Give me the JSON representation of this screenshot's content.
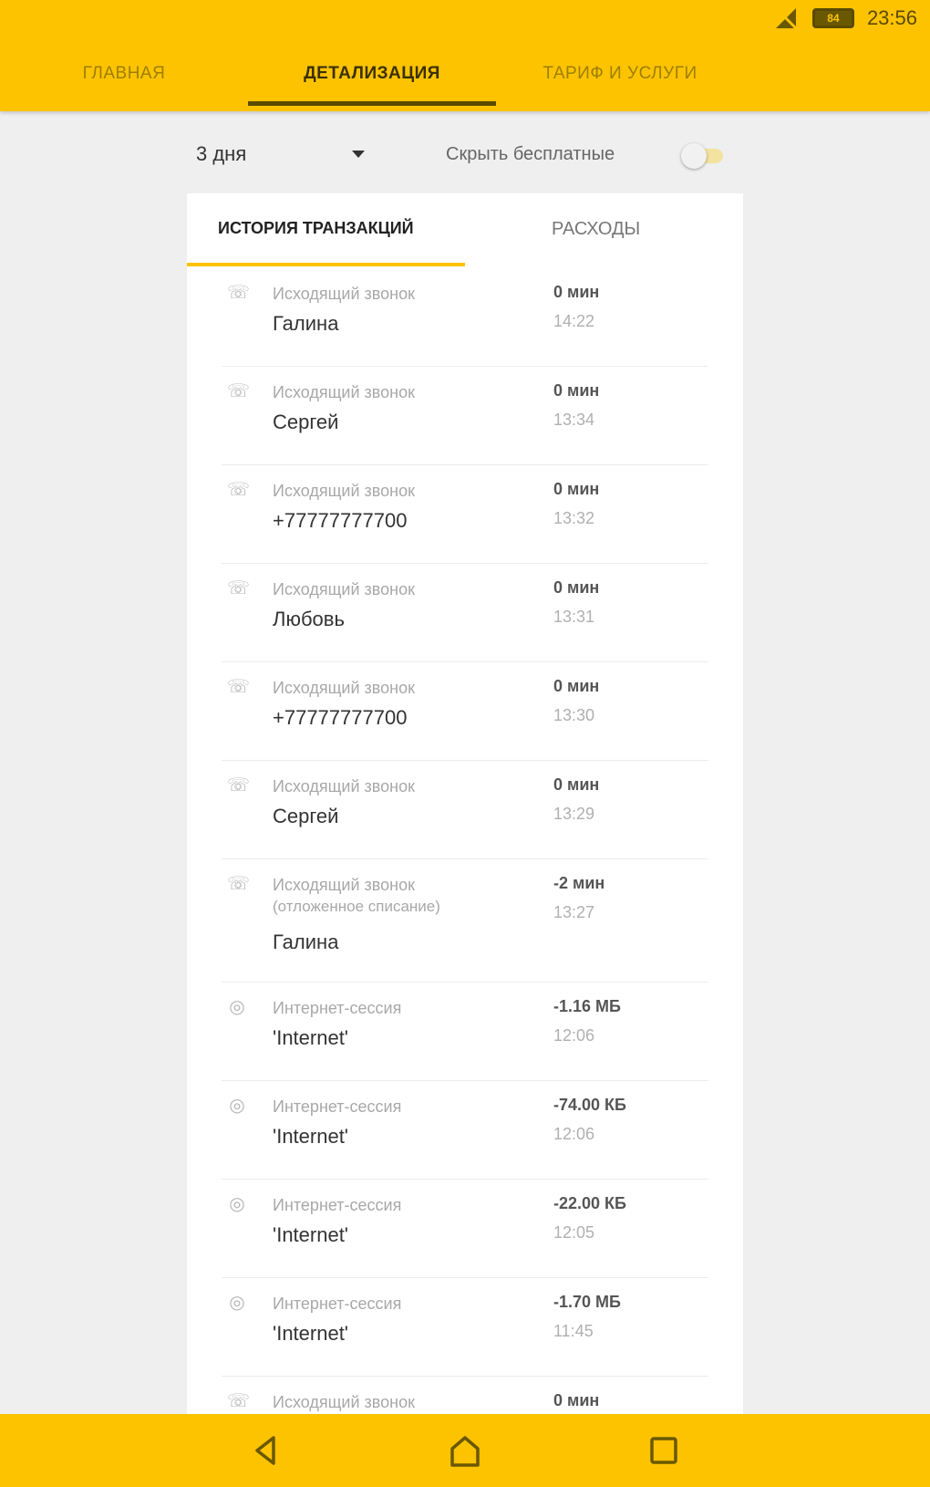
{
  "status_bar": {
    "time": "23:56",
    "battery": "84"
  },
  "tabs": [
    {
      "label": "Главная"
    },
    {
      "label": "Детализация"
    },
    {
      "label": "Тариф и услуги"
    }
  ],
  "filter": {
    "period": "3 дня",
    "hide_free_label": "Скрыть бесплатные"
  },
  "subtabs": {
    "history": "История транзакций",
    "expenses": "Расходы"
  },
  "rows": [
    {
      "icon": "phone-icon",
      "desc": "Исходящий звонок",
      "desc2": "",
      "name": "Галина",
      "amount": "0 мин",
      "time": "14:22"
    },
    {
      "icon": "phone-icon",
      "desc": "Исходящий звонок",
      "desc2": "",
      "name": "Сергей",
      "amount": "0 мин",
      "time": "13:34"
    },
    {
      "icon": "phone-icon",
      "desc": "Исходящий звонок",
      "desc2": "",
      "name": "+77777777700",
      "amount": "0 мин",
      "time": "13:32"
    },
    {
      "icon": "phone-icon",
      "desc": "Исходящий звонок",
      "desc2": "",
      "name": "Любовь",
      "amount": "0 мин",
      "time": "13:31"
    },
    {
      "icon": "phone-icon",
      "desc": "Исходящий звонок",
      "desc2": "",
      "name": "+77777777700",
      "amount": "0 мин",
      "time": "13:30"
    },
    {
      "icon": "phone-icon",
      "desc": "Исходящий звонок",
      "desc2": "",
      "name": "Сергей",
      "amount": "0 мин",
      "time": "13:29"
    },
    {
      "icon": "phone-icon",
      "desc": "Исходящий звонок",
      "desc2": "(отложенное списание)",
      "name": "Галина",
      "amount": "-2 мин",
      "time": "13:27"
    },
    {
      "icon": "globe-icon",
      "desc": "Интернет-сессия",
      "desc2": "",
      "name": "'Internet'",
      "amount": "-1.16 МБ",
      "time": "12:06"
    },
    {
      "icon": "globe-icon",
      "desc": "Интернет-сессия",
      "desc2": "",
      "name": "'Internet'",
      "amount": "-74.00 КБ",
      "time": "12:06"
    },
    {
      "icon": "globe-icon",
      "desc": "Интернет-сессия",
      "desc2": "",
      "name": "'Internet'",
      "amount": "-22.00 КБ",
      "time": "12:05"
    },
    {
      "icon": "globe-icon",
      "desc": "Интернет-сессия",
      "desc2": "",
      "name": "'Internet'",
      "amount": "-1.70 МБ",
      "time": "11:45"
    },
    {
      "icon": "phone-icon",
      "desc": "Исходящий звонок",
      "desc2": "",
      "name": "",
      "amount": "0 мин",
      "time": ""
    }
  ],
  "colors": {
    "brand_yellow": "#fdc300",
    "accent_dark": "#5a4a00"
  }
}
